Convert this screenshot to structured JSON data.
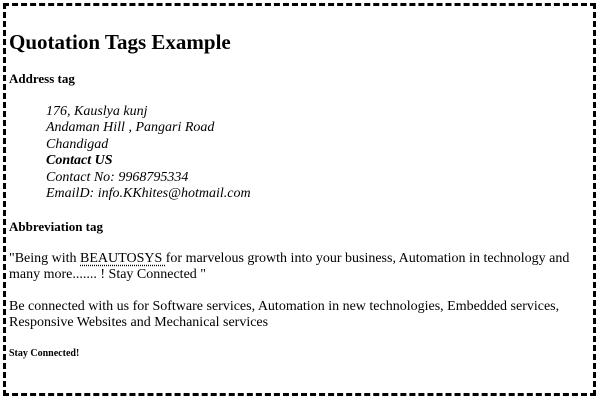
{
  "page": {
    "title": "Quotation Tags Example"
  },
  "address_section": {
    "heading": "Address tag",
    "lines": [
      "176, Kauslya kunj",
      "Andaman Hill , Pangari Road",
      "Chandigad",
      "Contact US",
      "Contact No: 9968795334",
      "EmailD: info.KKhites@hotmail.com"
    ]
  },
  "abbreviation_section": {
    "heading": "Abbreviation tag",
    "quote_prefix": "\"Being with ",
    "abbr_text": "BEAUTOSYS ",
    "quote_suffix": "for marvelous growth into your business, Automation in technology and many more....... ! Stay Connected \"",
    "paragraph": "Be connected with us for Software services, Automation in new technologies, Embedded services, Responsive Websites and Mechanical services",
    "footer": "Stay Connected!"
  }
}
